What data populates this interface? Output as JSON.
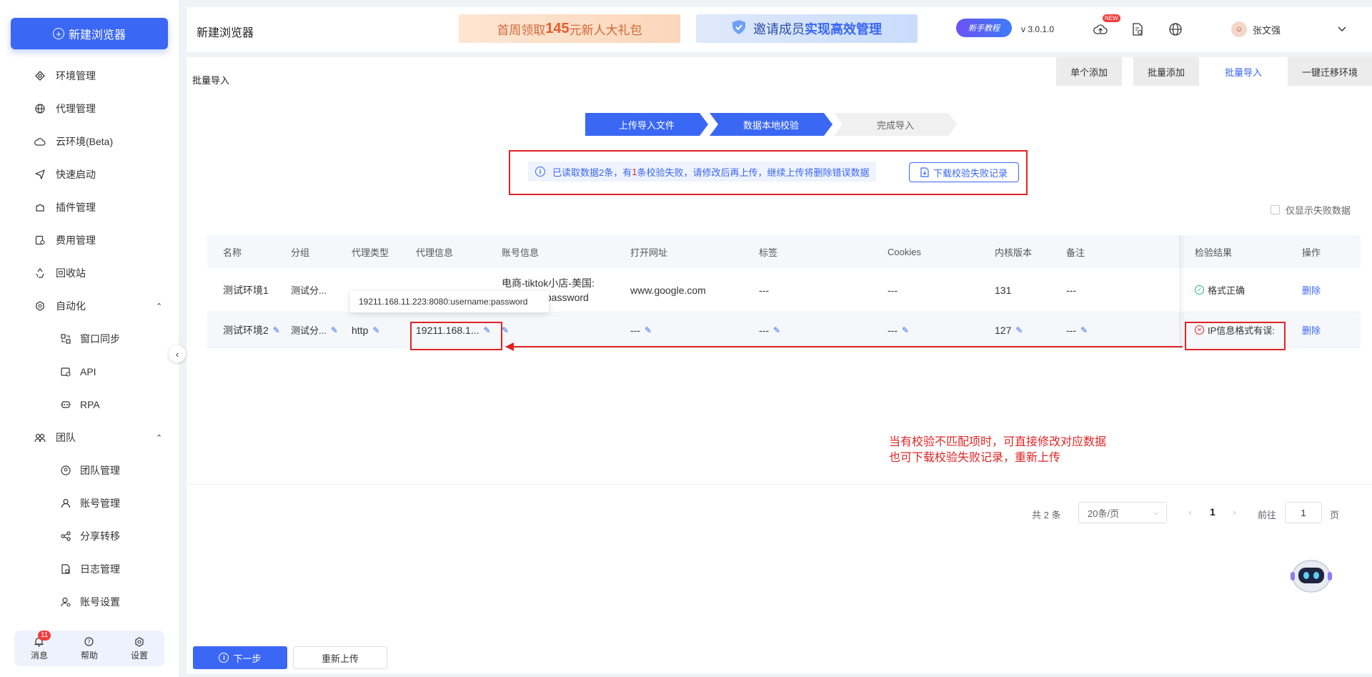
{
  "sidebar": {
    "new_button": "新建浏览器",
    "items": [
      {
        "label": "环境管理"
      },
      {
        "label": "代理管理"
      },
      {
        "label": "云环境(Beta)"
      },
      {
        "label": "快速启动"
      },
      {
        "label": "插件管理"
      },
      {
        "label": "费用管理"
      },
      {
        "label": "回收站"
      },
      {
        "label": "自动化"
      },
      {
        "label": "窗口同步"
      },
      {
        "label": "API"
      },
      {
        "label": "RPA"
      },
      {
        "label": "团队"
      },
      {
        "label": "团队管理"
      },
      {
        "label": "账号管理"
      },
      {
        "label": "分享转移"
      },
      {
        "label": "日志管理"
      },
      {
        "label": "账号设置"
      }
    ],
    "bottom": {
      "messages": "消息",
      "messages_count": "11",
      "help": "帮助",
      "settings": "设置"
    }
  },
  "header": {
    "title": "新建浏览器",
    "banner1_pre": "首周领取",
    "banner1_num": "145",
    "banner1_post": "元新人大礼包",
    "banner2_pre": "邀请成员",
    "banner2_hl": "实现高效管理",
    "tutorial": "新手教程",
    "version": "v 3.0.1.0",
    "new_tag": "NEW",
    "user_name": "张文强"
  },
  "main": {
    "page_title": "批量导入",
    "tabs": [
      "单个添加",
      "批量添加",
      "批量导入",
      "一键迁移环境"
    ],
    "steps": [
      "上传导入文件",
      "数据本地校验",
      "完成导入"
    ],
    "alert": {
      "pre": "已读取数据2条，有",
      "count": "1",
      "post": "条校验失败，请修改后再上传，继续上传将删除错误数据",
      "download": "下载校验失败记录"
    },
    "only_fail": "仅显示失败数据",
    "columns": [
      "名称",
      "分组",
      "代理类型",
      "代理信息",
      "账号信息",
      "打开网址",
      "标签",
      "Cookies",
      "内核版本",
      "备注",
      "检验结果",
      "操作"
    ],
    "rows": [
      {
        "name": "测试环境1",
        "group": "测试分...",
        "proxy_type": "",
        "proxy_info": "",
        "account_line1": "电商-tiktok小店-美国:",
        "account_line2": "/password",
        "url": "www.google.com",
        "tags": "---",
        "cookies": "---",
        "kernel": "131",
        "remark": "---",
        "result": "格式正确",
        "action": "删除"
      },
      {
        "name": "测试环境2",
        "group": "测试分...",
        "proxy_type": "http",
        "proxy_info": "19211.168.1...",
        "account": "",
        "url": "---",
        "tags": "---",
        "cookies": "---",
        "kernel": "127",
        "remark": "---",
        "result": "IP信息格式有误:",
        "action": "删除"
      }
    ],
    "tooltip": "19211.168.11.223:8080:username:password",
    "annotation_line1": "当有校验不匹配项时，可直接修改对应数据",
    "annotation_line2": "也可下载校验失败记录，重新上传",
    "pager": {
      "total": "共 2 条",
      "page_size": "20条/页",
      "current": "1",
      "goto": "前往",
      "goto_value": "1",
      "page_unit": "页"
    },
    "next_button": "下一步",
    "reupload_button": "重新上传"
  },
  "colors": {
    "primary": "#3a67f4",
    "error": "#e02424",
    "success": "#19be6b"
  }
}
